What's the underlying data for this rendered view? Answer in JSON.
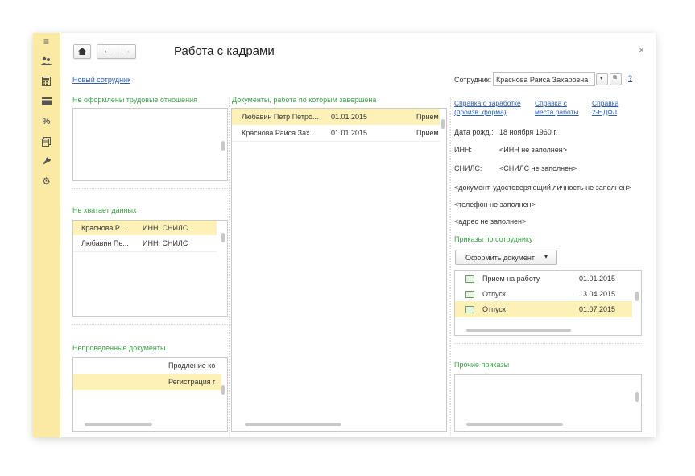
{
  "window": {
    "title": "Работа с кадрами",
    "close": "×"
  },
  "toolbar": {
    "home_icon": "home-icon",
    "back_icon": "←",
    "forward_icon": "→"
  },
  "left": {
    "new_employee": "Новый сотрудник",
    "no_relations_title": "Не оформлены трудовые отношения",
    "missing_title": "Не хватает данных",
    "missing_rows": [
      {
        "name": "Краснова Р...",
        "what": "ИНН, СНИЛС"
      },
      {
        "name": "Любавин Пе...",
        "what": "ИНН, СНИЛС"
      }
    ],
    "unposted_title": "Непроведенные документы",
    "unposted_rows": [
      {
        "text": "Продление ко"
      },
      {
        "text": "Регистрация г"
      }
    ]
  },
  "middle": {
    "title": "Документы, работа по которым завершена",
    "rows": [
      {
        "name": "Любавин Петр Петро...",
        "date": "01.01.2015",
        "type": "Прием"
      },
      {
        "name": "Краснова Раиса Зах...",
        "date": "01.01.2015",
        "type": "Прием"
      }
    ]
  },
  "right": {
    "employee_label": "Сотрудник:",
    "employee_value": "Краснова Раиса Захаровна",
    "help": "?",
    "link1_line1": "Справка о заработке",
    "link1_line2": "(произв. форма)",
    "link2_line1": "Справка с",
    "link2_line2": "места работы",
    "link3_line1": "Справка",
    "link3_line2": "2-НДФЛ",
    "birth_label": "Дата рожд.:",
    "birth_value": "18 ноября 1960 г.",
    "inn_label": "ИНН:",
    "inn_value": "<ИНН не заполнен>",
    "snils_label": "СНИЛС:",
    "snils_value": "<СНИЛС не заполнен>",
    "doc_missing": "<документ, удостоверяющий личность не заполнен>",
    "phone_missing": "<телефон не заполнен>",
    "address_missing": "<адрес не заполнен>",
    "orders_title": "Приказы по сотруднику",
    "make_doc_button": "Оформить документ",
    "orders": [
      {
        "name": "Прием на работу",
        "date": "01.01.2015"
      },
      {
        "name": "Отпуск",
        "date": "13.04.2015"
      },
      {
        "name": "Отпуск",
        "date": "01.07.2015"
      }
    ],
    "other_orders_title": "Прочие приказы"
  }
}
